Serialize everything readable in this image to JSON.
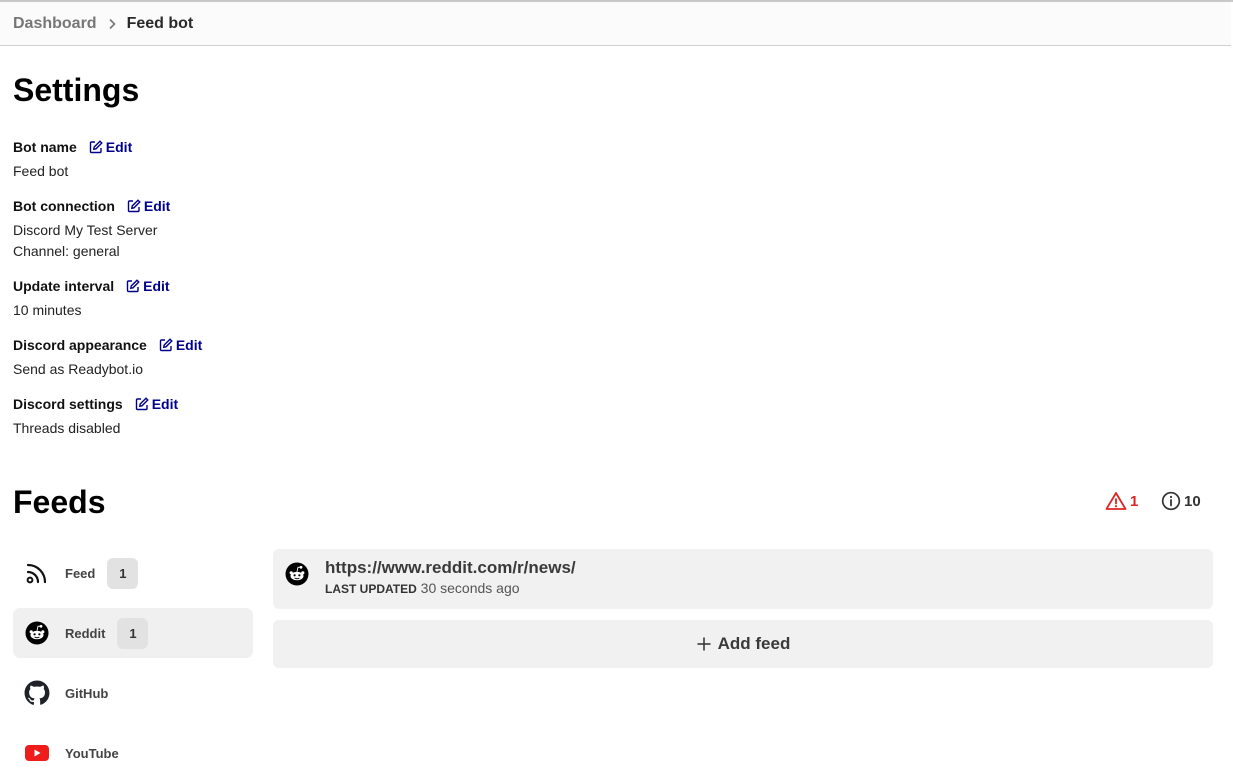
{
  "breadcrumb": {
    "items": [
      {
        "label": "Dashboard"
      },
      {
        "label": "Feed bot"
      }
    ]
  },
  "settings": {
    "title": "Settings",
    "edit_label": "Edit",
    "items": [
      {
        "label": "Bot name",
        "values": [
          "Feed bot"
        ]
      },
      {
        "label": "Bot connection",
        "values": [
          "Discord My Test Server",
          "Channel: general"
        ]
      },
      {
        "label": "Update interval",
        "values": [
          "10 minutes"
        ]
      },
      {
        "label": "Discord appearance",
        "values": [
          "Send as Readybot.io"
        ]
      },
      {
        "label": "Discord settings",
        "values": [
          "Threads disabled"
        ]
      }
    ]
  },
  "feeds": {
    "title": "Feeds",
    "warnings": {
      "icon": "warning-triangle-icon",
      "count": "1",
      "color": "#e02424"
    },
    "info": {
      "icon": "info-circle-icon",
      "count": "10"
    },
    "nav": [
      {
        "label": "Feed",
        "icon": "rss-icon",
        "badge": "1",
        "active": false
      },
      {
        "label": "Reddit",
        "icon": "reddit-icon",
        "badge": "1",
        "active": true
      },
      {
        "label": "GitHub",
        "icon": "github-icon",
        "badge": null,
        "active": false
      },
      {
        "label": "YouTube",
        "icon": "youtube-icon",
        "badge": null,
        "active": false
      }
    ],
    "list": [
      {
        "url": "https://www.reddit.com/r/news/",
        "last_updated_label": "LAST UPDATED",
        "last_updated": "30 seconds ago",
        "icon": "reddit-icon"
      }
    ],
    "add_label": "Add feed"
  },
  "colors": {
    "link": "#00008b",
    "warning": "#e02424",
    "youtube": "#ee1c1b",
    "card_bg": "#f1f1f1"
  }
}
